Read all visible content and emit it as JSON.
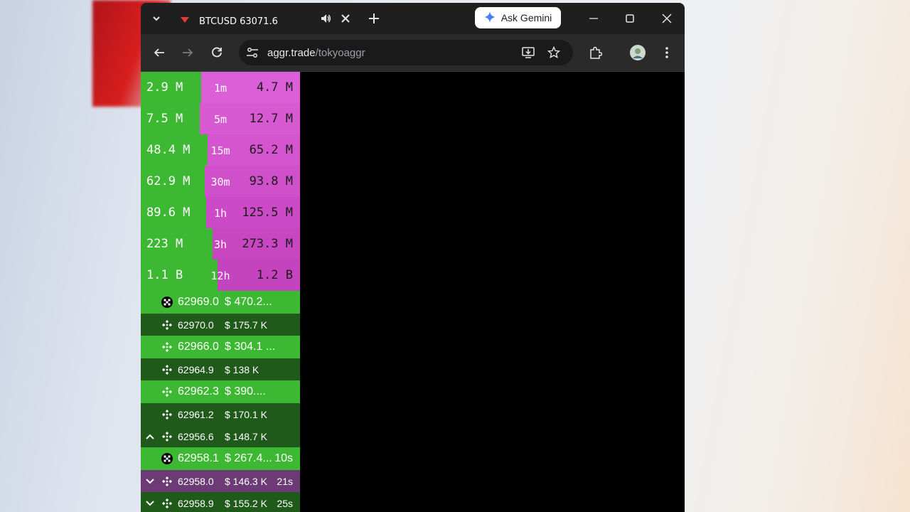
{
  "browser": {
    "tab": {
      "title": "BTCUSD 63071.6"
    },
    "ask_gemini_label": "Ask Gemini",
    "url": {
      "host": "aggr.trade",
      "path": "/tokyoaggr"
    }
  },
  "colors": {
    "buy": "#3db832",
    "sell": "#d94fd2",
    "buy_dark": "#1f5a1a",
    "sell_dark": "#6c3a74"
  },
  "stats": [
    {
      "buy": "2.9 M",
      "interval": "1m",
      "sell": "4.7 M",
      "buy_share": 0.38
    },
    {
      "buy": "7.5 M",
      "interval": "5m",
      "sell": "12.7 M",
      "buy_share": 0.37
    },
    {
      "buy": "48.4 M",
      "interval": "15m",
      "sell": "65.2 M",
      "buy_share": 0.42
    },
    {
      "buy": "62.9 M",
      "interval": "30m",
      "sell": "93.8 M",
      "buy_share": 0.4
    },
    {
      "buy": "89.6 M",
      "interval": "1h",
      "sell": "125.5 M",
      "buy_share": 0.41
    },
    {
      "buy": "223 M",
      "interval": "3h",
      "sell": "273.3 M",
      "buy_share": 0.45
    },
    {
      "buy": "1.1 B",
      "interval": "12h",
      "sell": "1.2 B",
      "buy_share": 0.48
    }
  ],
  "trades": [
    {
      "exchange_icon": "okx-icon",
      "arrow": "",
      "price": "62969.0",
      "amount": "$ 470.2...",
      "time": "",
      "side": "buy",
      "size": "big"
    },
    {
      "exchange_icon": "binance-icon",
      "arrow": "",
      "price": "62970.0",
      "amount": "$ 175.7 K",
      "time": "",
      "side": "buy_dark",
      "size": "small"
    },
    {
      "exchange_icon": "binance-icon",
      "arrow": "",
      "price": "62966.0",
      "amount": "$ 304.1 ...",
      "time": "",
      "side": "buy",
      "size": "big"
    },
    {
      "exchange_icon": "binance-icon",
      "arrow": "",
      "price": "62964.9",
      "amount": "$ 138 K",
      "time": "",
      "side": "buy_dark",
      "size": "small"
    },
    {
      "exchange_icon": "binance-icon",
      "arrow": "",
      "price": "62962.3",
      "amount": "$ 390....",
      "time": "",
      "side": "buy",
      "size": "big"
    },
    {
      "exchange_icon": "binance-icon",
      "arrow": "",
      "price": "62961.2",
      "amount": "$ 170.1 K",
      "time": "",
      "side": "buy_dark",
      "size": "small"
    },
    {
      "exchange_icon": "binance-icon",
      "arrow": "^",
      "price": "62956.6",
      "amount": "$ 148.7 K",
      "time": "",
      "side": "buy_dark",
      "size": "small"
    },
    {
      "exchange_icon": "okx-icon",
      "arrow": "",
      "price": "62958.1",
      "amount": "$ 267.4...",
      "time": "10s",
      "side": "buy",
      "size": "big"
    },
    {
      "exchange_icon": "binance-icon",
      "arrow": "v",
      "price": "62958.0",
      "amount": "$ 146.3 K",
      "time": "21s",
      "side": "sell_dark",
      "size": "small"
    },
    {
      "exchange_icon": "binance-icon",
      "arrow": "v",
      "price": "62958.9",
      "amount": "$ 155.2 K",
      "time": "25s",
      "side": "buy_dark",
      "size": "small"
    }
  ]
}
